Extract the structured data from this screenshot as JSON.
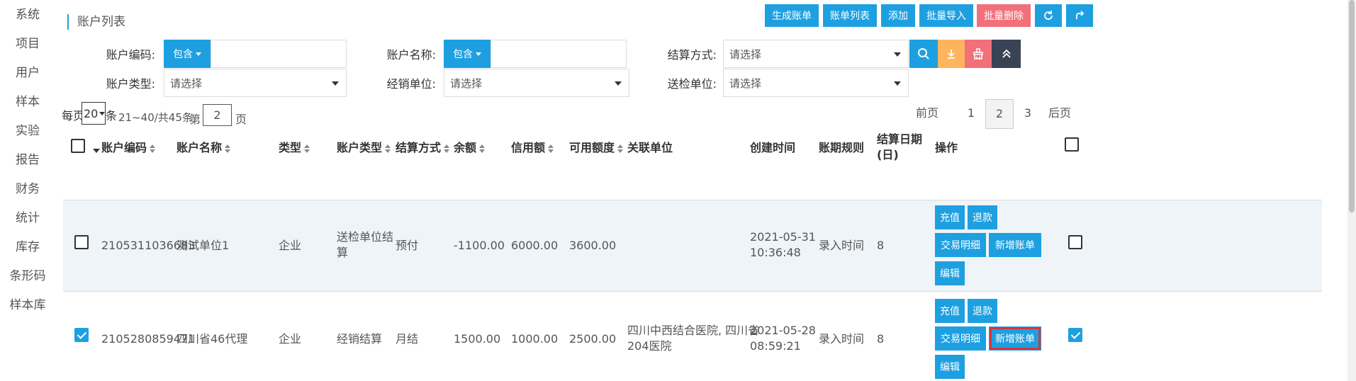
{
  "sidebar": {
    "items": [
      {
        "label": "系统"
      },
      {
        "label": "项目"
      },
      {
        "label": "用户"
      },
      {
        "label": "样本"
      },
      {
        "label": "实验"
      },
      {
        "label": "报告"
      },
      {
        "label": "财务"
      },
      {
        "label": "统计"
      },
      {
        "label": "库存"
      },
      {
        "label": "条形码"
      },
      {
        "label": "样本库"
      }
    ]
  },
  "header": {
    "title": "账户列表",
    "buttons": {
      "generate_bill": "生成账单",
      "bill_list": "账单列表",
      "add": "添加",
      "batch_import": "批量导入",
      "batch_delete": "批量删除"
    },
    "icons": {
      "refresh": "refresh-icon",
      "share": "share-icon"
    }
  },
  "filters": {
    "account_code": {
      "label": "账户编码:",
      "mode": "包含",
      "value": ""
    },
    "account_name": {
      "label": "账户名称:",
      "mode": "包含",
      "value": ""
    },
    "settlement_method": {
      "label": "结算方式:",
      "value": "请选择"
    },
    "account_type": {
      "label": "账户类型:",
      "value": "请选择"
    },
    "dealer_unit": {
      "label": "经销单位:",
      "value": "请选择"
    },
    "inspection_unit": {
      "label": "送检单位:",
      "value": "请选择"
    },
    "action_icons": [
      "search-icon",
      "download-icon",
      "clear-icon",
      "collapse-icon"
    ]
  },
  "pager": {
    "per_page_prefix": "每页",
    "per_page": "20",
    "per_page_suffix": "条",
    "range": "21~40/共45条",
    "page_prefix": "第",
    "page_value": "2",
    "page_suffix": "页",
    "prev": "前页",
    "pages": [
      "1",
      "2",
      "3"
    ],
    "active_page": "2",
    "next": "后页"
  },
  "table": {
    "columns": {
      "code": "账户编码",
      "name": "账户名称",
      "type": "类型",
      "account_type": "账户类型",
      "settlement": "结算方式",
      "balance": "余额",
      "credit": "信用额",
      "available": "可用额度",
      "related": "关联单位",
      "created": "创建时间",
      "period_rule": "账期规则",
      "settle_date_1": "结算日期",
      "settle_date_2": "(日)",
      "ops": "操作"
    },
    "rows": [
      {
        "checked": false,
        "code": "2105311036683",
        "name": "测试单位1",
        "type": "企业",
        "account_type_1": "送检单位结",
        "account_type_2": "算",
        "settlement": "预付",
        "balance": "-1100.00",
        "credit": "6000.00",
        "available": "3600.00",
        "related_1": "",
        "related_2": "",
        "created_1": "2021-05-31",
        "created_2": "10:36:48",
        "period_rule": "录入时间",
        "settle_day": "8"
      },
      {
        "checked": true,
        "code": "2105280859471",
        "name": "四川省46代理",
        "type": "企业",
        "account_type_1": "经销结算",
        "account_type_2": "",
        "settlement": "月结",
        "balance": "1500.00",
        "credit": "1000.00",
        "available": "2500.00",
        "related_1": "四川中西结合医院, 四川省",
        "related_2": "204医院",
        "created_1": "2021-05-28",
        "created_2": "08:59:21",
        "period_rule": "录入时间",
        "settle_day": "8"
      }
    ],
    "op_labels": {
      "recharge": "充值",
      "refund": "退款",
      "transactions": "交易明细",
      "new_bill": "新增账单",
      "edit": "编辑"
    }
  },
  "colors": {
    "primary": "#1ea0e0",
    "danger": "#f1707a",
    "warning": "#fdb45c",
    "dark": "#3a4356",
    "row_highlight": "#eef4f8",
    "focus_outline": "#d9363e"
  }
}
